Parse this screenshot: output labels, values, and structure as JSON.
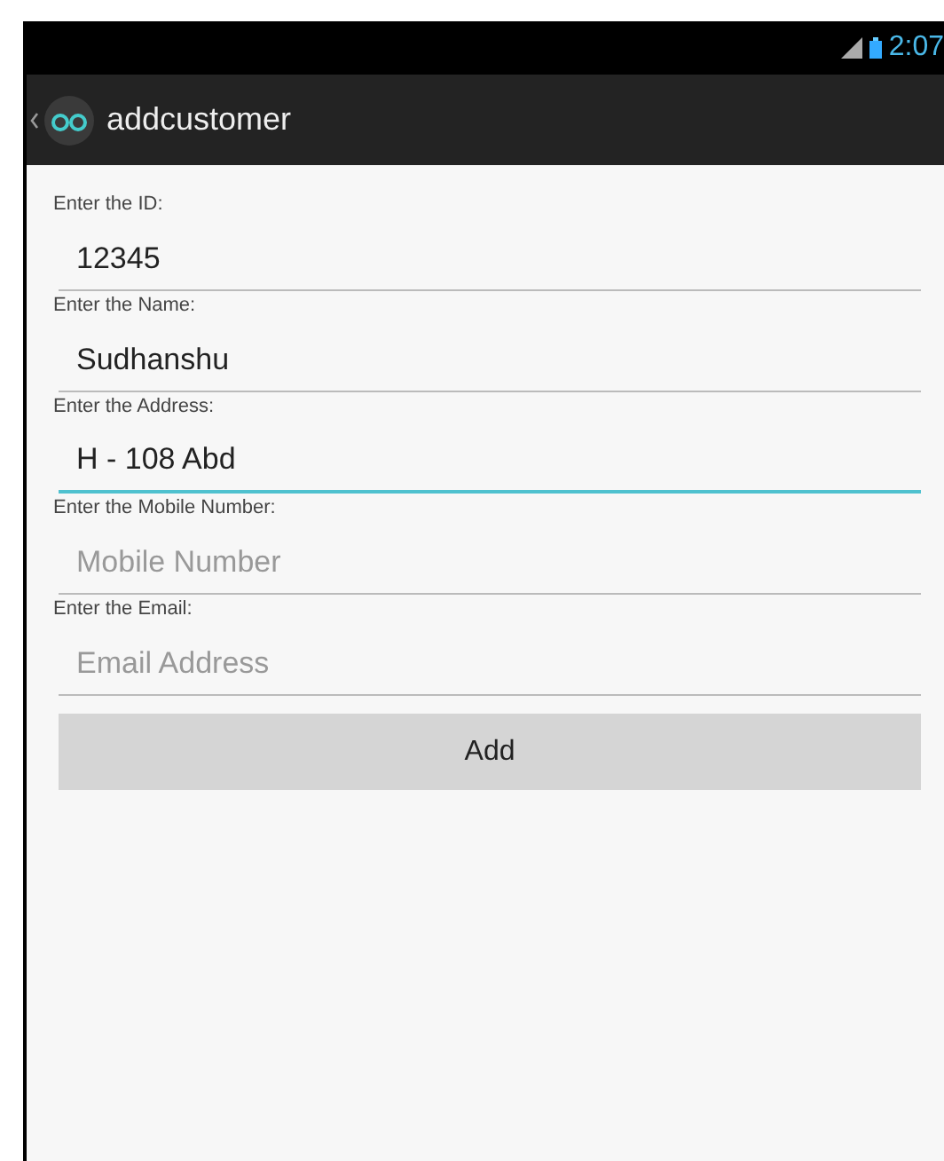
{
  "status_bar": {
    "time": "2:07"
  },
  "action_bar": {
    "title": "addcustomer"
  },
  "fields": [
    {
      "label": "Enter the ID:",
      "value": "12345",
      "focused": false
    },
    {
      "label": "Enter the Name:",
      "value": "Sudhanshu",
      "focused": false
    },
    {
      "label": "Enter the Address:",
      "value": "H - 108 Abd",
      "focused": true
    },
    {
      "label": "Enter the Mobile Number:",
      "placeholder": "Mobile Number",
      "focused": false
    },
    {
      "label": "Enter the Email:",
      "placeholder": "Email Address",
      "focused": false
    }
  ],
  "button": {
    "label": "Add"
  }
}
